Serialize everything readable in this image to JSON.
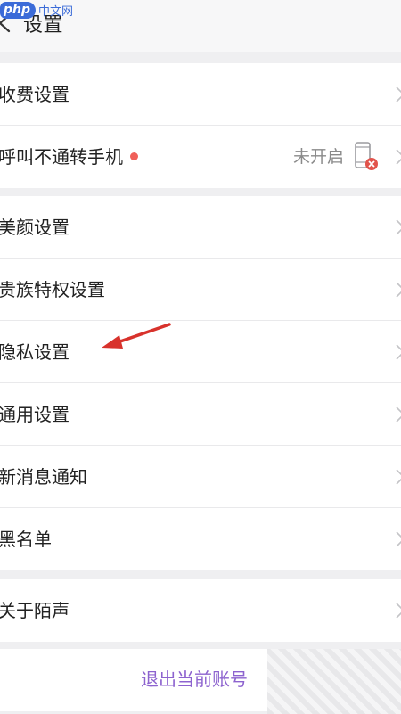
{
  "watermark": {
    "logo": "php",
    "text": "中文网"
  },
  "header": {
    "title": "设置"
  },
  "groups": [
    {
      "items": [
        {
          "label": "收费设置"
        },
        {
          "label": "呼叫不通转手机",
          "value": "未开启"
        }
      ]
    },
    {
      "items": [
        {
          "label": "美颜设置"
        },
        {
          "label": "贵族特权设置"
        },
        {
          "label": "隐私设置"
        },
        {
          "label": "通用设置"
        },
        {
          "label": "新消息通知"
        },
        {
          "label": "黑名单"
        }
      ]
    },
    {
      "items": [
        {
          "label": "关于陌声"
        }
      ]
    }
  ],
  "logout": {
    "label": "退出当前账号"
  },
  "colors": {
    "accent_purple": "#8d63cf",
    "badge_red": "#f0605a",
    "annotation_arrow": "#d8322c",
    "background": "#efeff1"
  }
}
